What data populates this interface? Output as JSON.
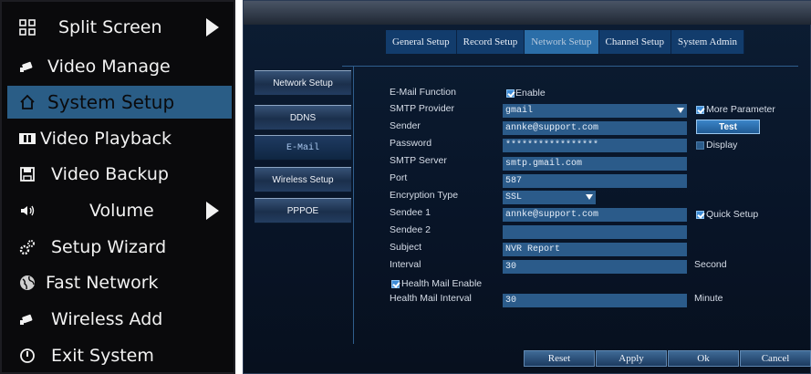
{
  "left_menu": {
    "items": [
      {
        "label": "Split Screen",
        "icon": "grid-icon",
        "has_arrow": true
      },
      {
        "label": "Video Manage",
        "icon": "camera-icon"
      },
      {
        "label": "System Setup",
        "icon": "home-icon",
        "active": true
      },
      {
        "label": "Video Playback",
        "icon": "film-icon"
      },
      {
        "label": "Video Backup",
        "icon": "floppy-icon"
      },
      {
        "label": "Volume",
        "icon": "speaker-icon",
        "has_arrow": true
      },
      {
        "label": "Setup Wizard",
        "icon": "gears-icon"
      },
      {
        "label": "Fast Network",
        "icon": "globe-icon"
      },
      {
        "label": "Wireless Add",
        "icon": "camera-icon"
      },
      {
        "label": "Exit System",
        "icon": "power-icon"
      }
    ],
    "active_color": "#2a5d86"
  },
  "top_tabs": [
    {
      "label": "General Setup"
    },
    {
      "label": "Record Setup"
    },
    {
      "label": "Network Setup",
      "active": true
    },
    {
      "label": "Channel Setup"
    },
    {
      "label": "System Admin"
    }
  ],
  "sub_nav": [
    {
      "label": "Network Setup"
    },
    {
      "label": "DDNS"
    },
    {
      "label": "E-Mail",
      "active": true
    },
    {
      "label": "Wireless Setup"
    },
    {
      "label": "PPPOE"
    }
  ],
  "email_form": {
    "email_function_label": "E-Mail Function",
    "enable_label": "Enable",
    "smtp_provider_label": "SMTP Provider",
    "smtp_provider_value": "gmail",
    "more_parameter_label": "More Parameter",
    "sender_label": "Sender",
    "sender_value": "annke@support.com",
    "test_label": "Test",
    "password_label": "Password",
    "password_value": "*****************",
    "display_label": "Display",
    "smtp_server_label": "SMTP Server",
    "smtp_server_value": "smtp.gmail.com",
    "port_label": "Port",
    "port_value": "587",
    "encryption_label": "Encryption Type",
    "encryption_value": "SSL",
    "sendee1_label": "Sendee 1",
    "sendee1_value": "annke@support.com",
    "quick_setup_label": "Quick Setup",
    "sendee2_label": "Sendee 2",
    "sendee2_value": "",
    "subject_label": "Subject",
    "subject_value": "NVR Report",
    "interval_label": "Interval",
    "interval_value": "30",
    "second_label": "Second",
    "health_mail_enable_label": "Health Mail Enable",
    "health_mail_interval_label": "Health Mail Interval",
    "health_mail_interval_value": "30",
    "minute_label": "Minute"
  },
  "bottom_buttons": {
    "reset": "Reset",
    "apply": "Apply",
    "ok": "Ok",
    "cancel": "Cancel"
  }
}
